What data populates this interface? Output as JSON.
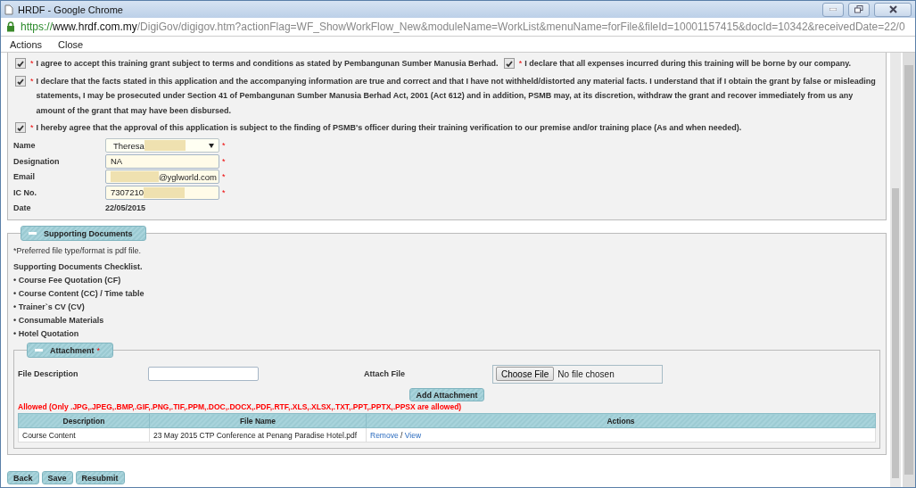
{
  "window": {
    "title": "HRDF - Google Chrome"
  },
  "address_bar": {
    "scheme": "https://",
    "host": "www.hrdf.com.my",
    "path": "/DigiGov/digigov.htm?actionFlag=WF_ShowWorkFlow_New&moduleName=WorkList&menuName=forFile&fileId=10001157415&docId=10342&receivedDate=22/0"
  },
  "menu": [
    "Actions",
    "Close"
  ],
  "declarations": [
    {
      "items": [
        {
          "mark": "*",
          "text": "I agree to accept this training grant subject to terms and conditions as stated by Pembangunan Sumber Manusia Berhad.",
          "checked": true
        },
        {
          "mark": "*",
          "text": "I declare that all expenses incurred during this training will be borne by our company.",
          "checked": true
        }
      ]
    },
    {
      "items": [
        {
          "mark": "*",
          "text": "I declare that the facts stated in this application and the accompanying information are true and correct and that I have not withheld/distorted any material facts. I understand that if I obtain the grant by false or misleading statements, I may be prosecuted under Section 41 of Pembangunan Sumber Manusia Berhad Act, 2001 (Act 612) and in addition, PSMB may, at its discretion, withdraw the grant and recover immediately from us any amount of the grant that may have been disbursed.",
          "checked": true
        }
      ]
    },
    {
      "items": [
        {
          "mark": "*",
          "text": "I hereby agree that the approval of this application is subject to the finding of PSMB's officer during their training verification to our premise and/or training place (As and when needed).",
          "checked": true
        }
      ]
    }
  ],
  "form_fields": [
    {
      "label": "Name",
      "kind": "select",
      "value": "Theresa",
      "redacted_after": true,
      "mark": "*"
    },
    {
      "label": "Designation",
      "kind": "text",
      "value": "NA",
      "mark": "*"
    },
    {
      "label": "Email",
      "kind": "text",
      "value": "@yglworld.com",
      "redacted_before": true,
      "mark": "*"
    },
    {
      "label": "IC No.",
      "kind": "text",
      "value": "7307210",
      "redacted_after": true,
      "mark": "*"
    },
    {
      "label": "Date",
      "kind": "static",
      "value": "22/05/2015"
    }
  ],
  "supporting_documents": {
    "title": "Supporting Documents",
    "note": "*Preferred file type/format is pdf file.",
    "checklist_title": "Supporting Documents Checklist.",
    "checklist": [
      "• Course Fee Quotation (CF)",
      "• Course Content (CC) / Time table",
      "• Trainer`s CV (CV)",
      "• Consumable Materials",
      "• Hotel Quotation"
    ],
    "attachment": {
      "title": "Attachment",
      "mark": "*",
      "file_description_label": "File Description",
      "attach_file_label": "Attach File",
      "choose_file_button": "Choose File",
      "file_status": "No file chosen",
      "add_button": "Add Attachment",
      "allowed_note": "Allowed (Only .JPG,.JPEG,.BMP,.GIF,.PNG,.TIF,.PPM,.DOC,.DOCX,.PDF,.RTF,.XLS,.XLSX,.TXT,.PPT,.PPTX,.PPSX are allowed)",
      "table": {
        "columns": [
          "Description",
          "File Name",
          "Actions"
        ],
        "rows": [
          {
            "description": "Course Content",
            "file_name": "23 May 2015 CTP Conference at Penang Paradise Hotel.pdf",
            "actions": [
              "Remove",
              "View"
            ],
            "separator": "/"
          }
        ]
      }
    }
  },
  "buttons": [
    "Back",
    "Save",
    "Resubmit"
  ]
}
